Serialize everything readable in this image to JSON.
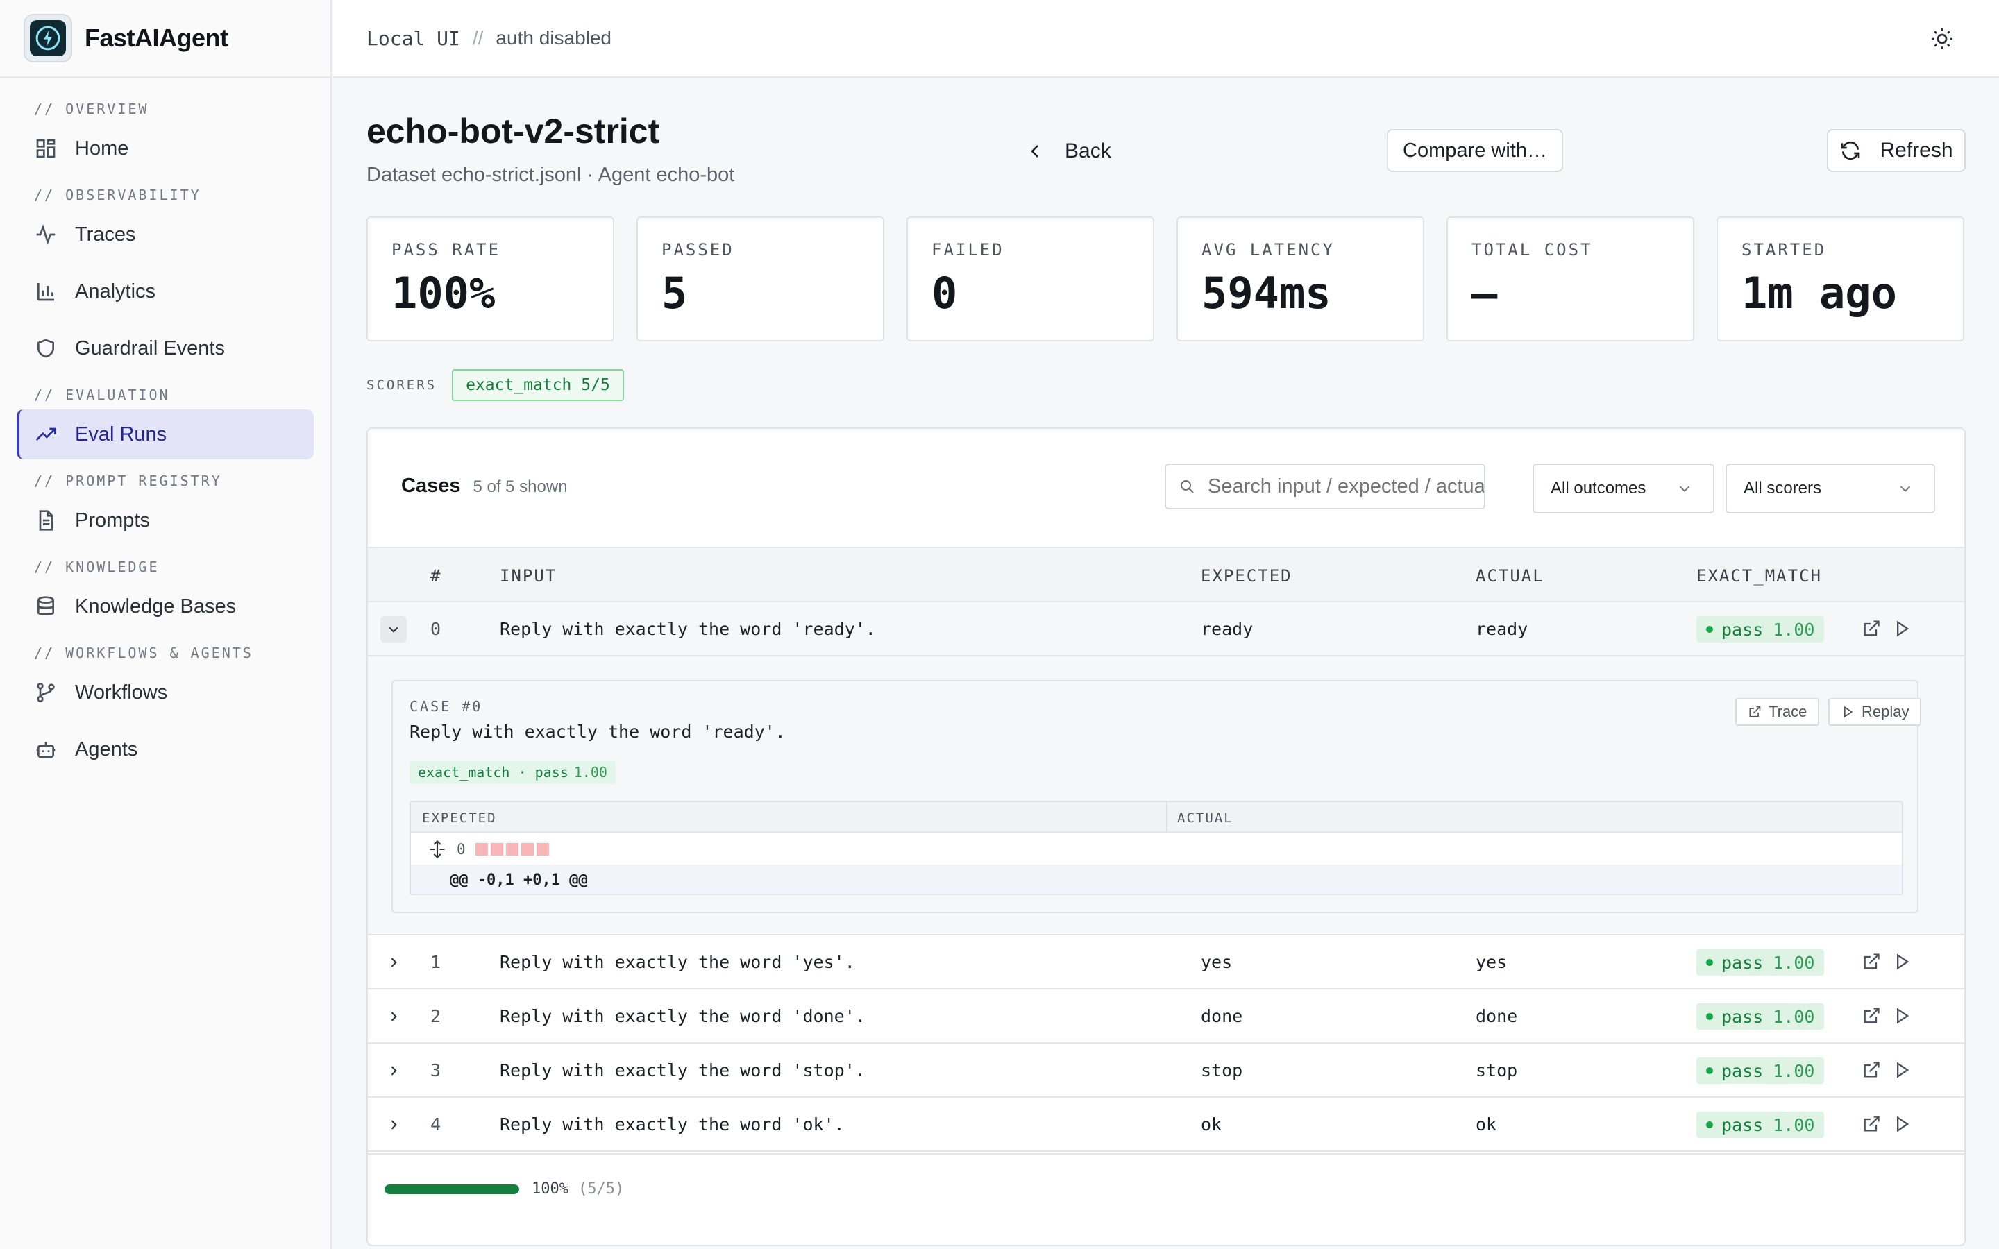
{
  "brand": {
    "name": "FastAIAgent"
  },
  "topbar": {
    "local": "Local UI",
    "sep": "//",
    "auth": "auth disabled"
  },
  "sidebar": {
    "sections": [
      {
        "label": "// OVERVIEW",
        "items": [
          {
            "label": "Home",
            "icon": "grid-icon"
          }
        ]
      },
      {
        "label": "// OBSERVABILITY",
        "items": [
          {
            "label": "Traces",
            "icon": "activity-icon"
          },
          {
            "label": "Analytics",
            "icon": "bar-chart-icon"
          },
          {
            "label": "Guardrail Events",
            "icon": "shield-icon"
          }
        ]
      },
      {
        "label": "// EVALUATION",
        "items": [
          {
            "label": "Eval Runs",
            "icon": "trending-up-icon",
            "active": true
          }
        ]
      },
      {
        "label": "// PROMPT REGISTRY",
        "items": [
          {
            "label": "Prompts",
            "icon": "document-icon"
          }
        ]
      },
      {
        "label": "// KNOWLEDGE",
        "items": [
          {
            "label": "Knowledge Bases",
            "icon": "database-icon"
          }
        ]
      },
      {
        "label": "// WORKFLOWS & AGENTS",
        "items": [
          {
            "label": "Workflows",
            "icon": "git-branch-icon"
          },
          {
            "label": "Agents",
            "icon": "bot-icon"
          }
        ]
      }
    ]
  },
  "header": {
    "title": "echo-bot-v2-strict",
    "subtitle": "Dataset echo-strict.jsonl · Agent echo-bot",
    "back_label": "Back",
    "compare_label": "Compare with…",
    "refresh_label": "Refresh"
  },
  "stats": [
    {
      "label": "PASS RATE",
      "value": "100%"
    },
    {
      "label": "PASSED",
      "value": "5"
    },
    {
      "label": "FAILED",
      "value": "0"
    },
    {
      "label": "AVG LATENCY",
      "value": "594ms"
    },
    {
      "label": "TOTAL COST",
      "value": "—"
    },
    {
      "label": "STARTED",
      "value": "1m ago"
    }
  ],
  "scorers": {
    "label": "SCORERS",
    "chip": "exact_match 5/5"
  },
  "cases": {
    "title": "Cases",
    "count": "5 of 5 shown",
    "search_placeholder": "Search input / expected / actual",
    "outcome_filter": "All outcomes",
    "scorer_filter": "All scorers",
    "columns": {
      "num": "#",
      "input": "INPUT",
      "expected": "EXPECTED",
      "actual": "ACTUAL",
      "scorer": "EXACT_MATCH"
    },
    "rows": [
      {
        "num": "0",
        "input": "Reply with exactly the word 'ready'.",
        "expected": "ready",
        "actual": "ready",
        "outcome": "pass",
        "score": "1.00"
      },
      {
        "num": "1",
        "input": "Reply with exactly the word 'yes'.",
        "expected": "yes",
        "actual": "yes",
        "outcome": "pass",
        "score": "1.00"
      },
      {
        "num": "2",
        "input": "Reply with exactly the word 'done'.",
        "expected": "done",
        "actual": "done",
        "outcome": "pass",
        "score": "1.00"
      },
      {
        "num": "3",
        "input": "Reply with exactly the word 'stop'.",
        "expected": "stop",
        "actual": "stop",
        "outcome": "pass",
        "score": "1.00"
      },
      {
        "num": "4",
        "input": "Reply with exactly the word 'ok'.",
        "expected": "ok",
        "actual": "ok",
        "outcome": "pass",
        "score": "1.00"
      }
    ],
    "detail": {
      "case_label": "CASE #0",
      "input": "Reply with exactly the word 'ready'.",
      "trace_label": "Trace",
      "replay_label": "Replay",
      "chip_name": "exact_match · pass",
      "chip_score": "1.00",
      "expected_header": "EXPECTED",
      "actual_header": "ACTUAL",
      "line_no": "0",
      "hunk": "@@ -0,1 +0,1 @@"
    },
    "progress": {
      "pct": "100%",
      "frac": "(5/5)",
      "fill": 1.0
    }
  },
  "colors": {
    "accent": "#3a3fb8",
    "pass": "#15803d",
    "pass_bg": "#dff3e5"
  }
}
